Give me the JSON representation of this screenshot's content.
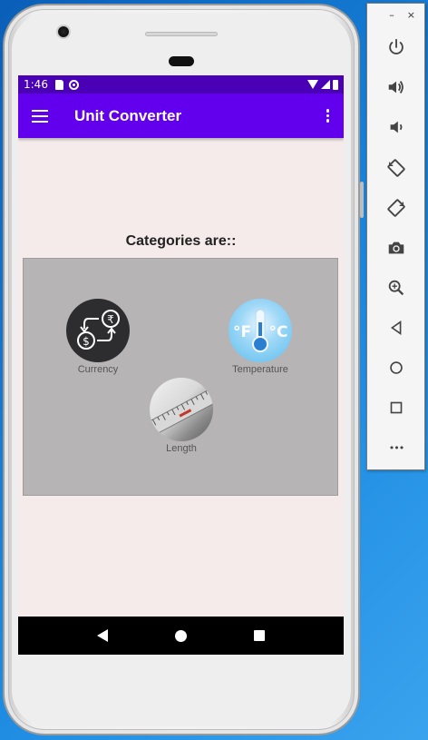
{
  "status_bar": {
    "time": "1:46"
  },
  "app_bar": {
    "title": "Unit Converter"
  },
  "main": {
    "heading": "Categories are::",
    "categories": [
      {
        "label": "Currency"
      },
      {
        "label": "Temperature"
      },
      {
        "label": "Length"
      }
    ]
  },
  "emulator": {
    "minimize": "–",
    "close": "×",
    "more": "•••"
  },
  "colors": {
    "status_bar": "#4a00b4",
    "app_bar": "#6200ee",
    "screen_bg": "#f4ebea",
    "grid_bg": "#b6b4b4"
  }
}
